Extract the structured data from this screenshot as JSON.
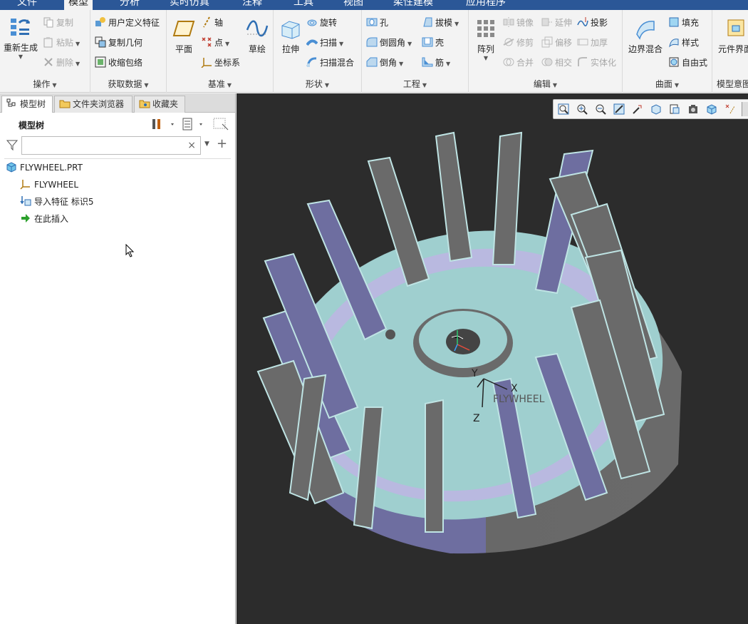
{
  "tabs": [
    "文件",
    "模型",
    "分析",
    "实时仿真",
    "注释",
    "工具",
    "视图",
    "柔性建模",
    "应用程序"
  ],
  "ribbon": {
    "regenerate": "重新生成",
    "copy": "复制",
    "paste": "粘贴",
    "delete": "删除",
    "user_feature": "用户定义特征",
    "copy_geom": "复制几何",
    "shrinkwrap": "收缩包络",
    "plane": "平面",
    "axis": "轴",
    "point": "点",
    "csys": "坐标系",
    "sketch": "草绘",
    "extrude": "拉伸",
    "revolve": "旋转",
    "sweep": "扫描",
    "swept_blend": "扫描混合",
    "hole": "孔",
    "round": "倒圆角",
    "chamfer": "倒角",
    "draft": "拔模",
    "shell": "壳",
    "rib": "筋",
    "pattern": "阵列",
    "mirror": "镜像",
    "extend": "延伸",
    "project": "投影",
    "trim": "修剪",
    "offset": "偏移",
    "thicken": "加厚",
    "merge": "合并",
    "intersect": "相交",
    "solidify": "实体化",
    "boundary_blend": "边界混合",
    "fill": "填充",
    "style": "样式",
    "freestyle": "自由式",
    "component_interface": "元件界面",
    "groups": {
      "ops": "操作",
      "get_data": "获取数据",
      "datum": "基准",
      "shapes": "形状",
      "engineering": "工程",
      "editing": "编辑",
      "surfaces": "曲面",
      "model_intent": "模型意图"
    }
  },
  "panel": {
    "tabs": [
      "模型树",
      "文件夹浏览器",
      "收藏夹"
    ],
    "title": "模型树",
    "tree": [
      "FLYWHEEL.PRT",
      "FLYWHEEL",
      "导入特征 标识5",
      "在此插入"
    ]
  },
  "viewport": {
    "csys_name": "FLYWHEEL",
    "axis_x": "X",
    "axis_y": "Y",
    "axis_z": "Z"
  },
  "colors": {
    "teal": "#9fcfcf",
    "purple": "#6e6ea0",
    "gray": "#6a6a6a",
    "bg": "#2c2c2c"
  }
}
